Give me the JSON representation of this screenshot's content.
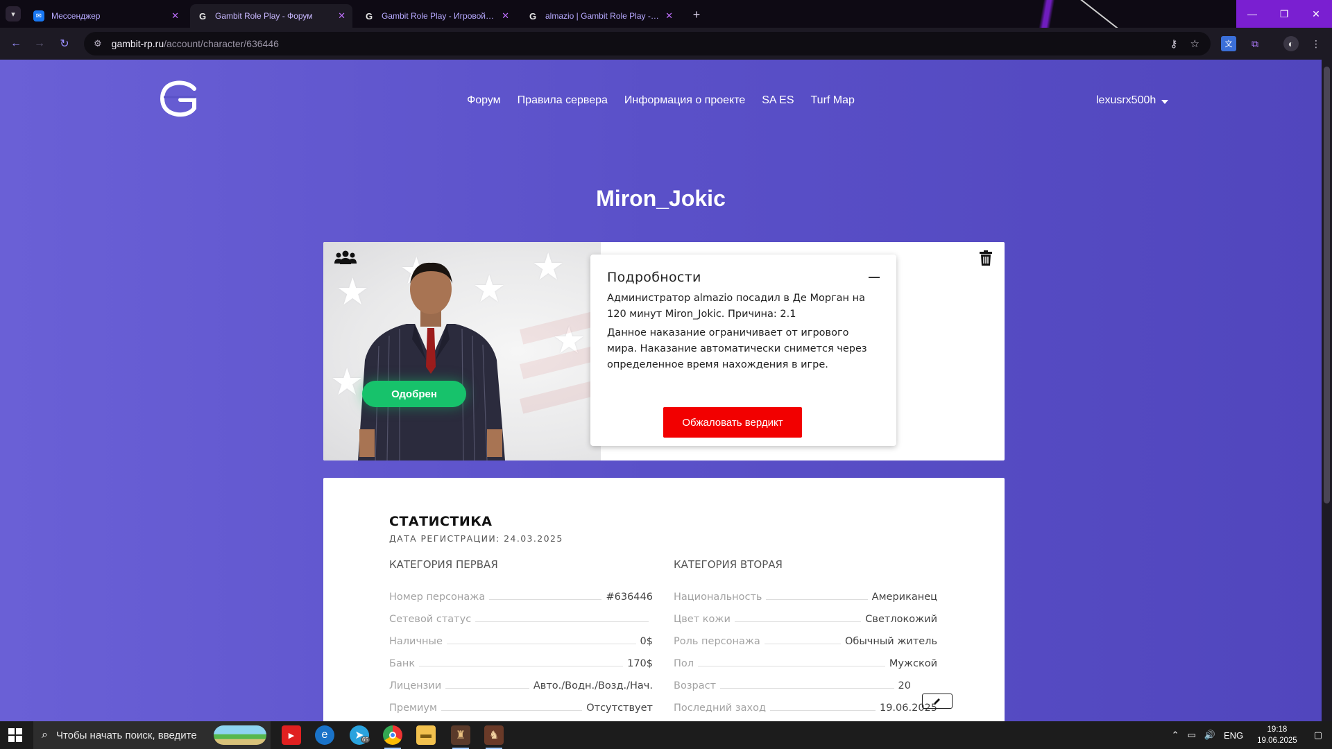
{
  "browser": {
    "tabs": [
      {
        "title": "Мессенджер",
        "active": false
      },
      {
        "title": "Gambit Role Play - Форум",
        "active": true
      },
      {
        "title": "Gambit Role Play - Игровой профиль",
        "active": false
      },
      {
        "title": "almazio | Gambit Role Play - Форум",
        "active": false
      }
    ],
    "url_host": "gambit-rp.ru",
    "url_path": "/account/character/636446"
  },
  "nav": {
    "items": [
      "Форум",
      "Правила сервера",
      "Информация о проекте",
      "SA ES",
      "Turf Map"
    ],
    "username": "lexusrx500h"
  },
  "character": {
    "name": "Miron_Jokic",
    "status_badge": "Одобрен"
  },
  "details": {
    "title": "Подробности",
    "text1": "Администратор almazio посадил в Де Морган на 120 минут Miron_Jokic. Причина: 2.1",
    "text2": "Данное наказание ограничивает от игрового мира. Наказание автоматически снимется через определенное время нахождения в игре.",
    "appeal_button": "Обжаловать вердикт"
  },
  "stats": {
    "title": "СТАТИСТИКА",
    "reg_date": "ДАТА РЕГИСТРАЦИИ: 24.03.2025",
    "col1": {
      "heading": "КАТЕГОРИЯ ПЕРВАЯ",
      "rows": [
        {
          "k": "Номер персонажа",
          "v": "#636446"
        },
        {
          "k": "Сетевой статус",
          "v": ""
        },
        {
          "k": "Наличные",
          "v": "0$"
        },
        {
          "k": "Банк",
          "v": "170$"
        },
        {
          "k": "Лицензии",
          "v": "Авто./Водн./Возд./Нач."
        },
        {
          "k": "Премиум",
          "v": "Отсутствует"
        }
      ]
    },
    "col2": {
      "heading": "КАТЕГОРИЯ ВТОРАЯ",
      "rows": [
        {
          "k": "Национальность",
          "v": "Американец"
        },
        {
          "k": "Цвет кожи",
          "v": "Светлокожий"
        },
        {
          "k": "Роль персонажа",
          "v": "Обычный житель"
        },
        {
          "k": "Пол",
          "v": "Мужской"
        },
        {
          "k": "Возраст",
          "v": "20"
        },
        {
          "k": "Последний заход",
          "v": "19.06.2025"
        }
      ]
    }
  },
  "taskbar": {
    "search_placeholder": "Чтобы начать поиск, введите",
    "lang": "ENG",
    "time": "19:18",
    "date": "19.06.2025",
    "telegram_badge": "65"
  }
}
